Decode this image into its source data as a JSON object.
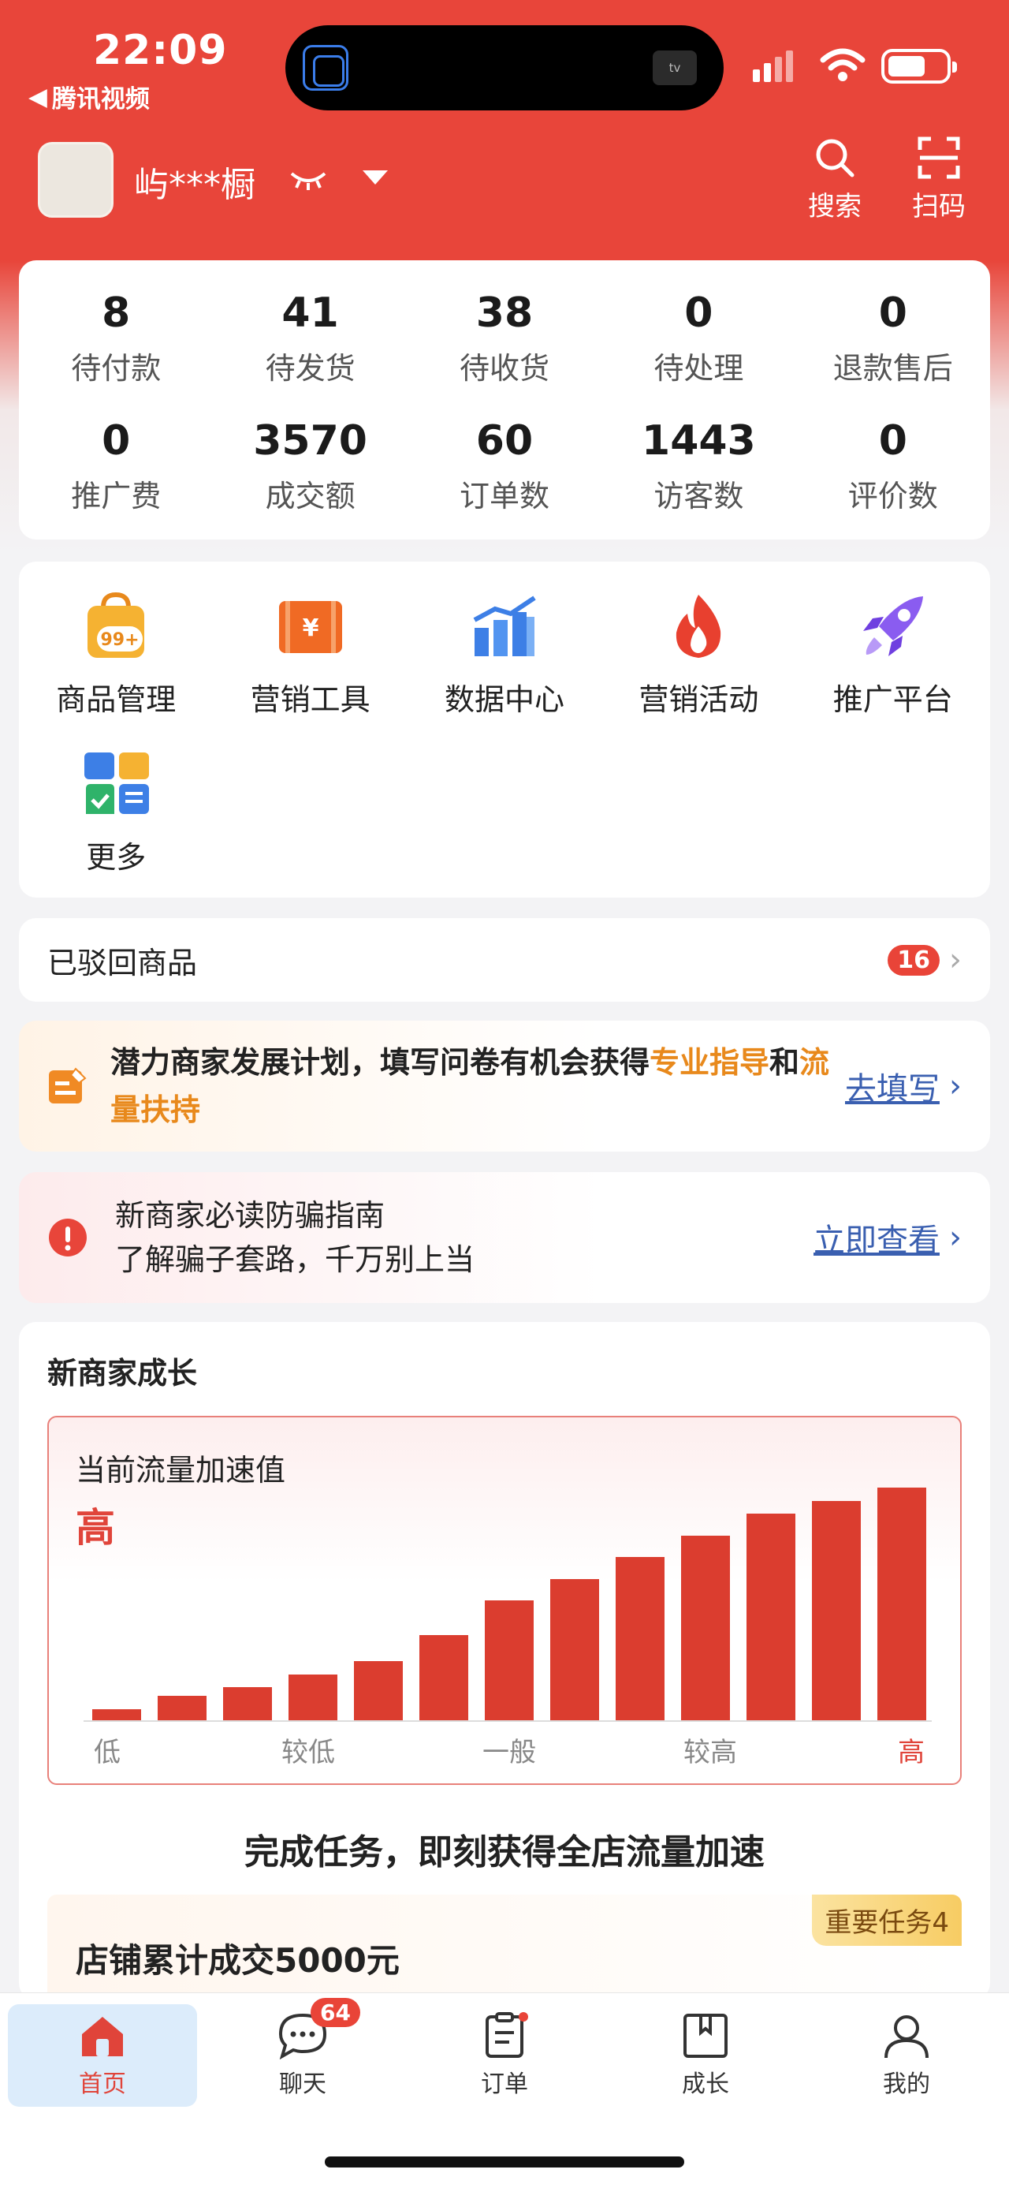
{
  "status_bar": {
    "time": "22:09",
    "back_app": "腾讯视频",
    "island_app": "tv"
  },
  "header": {
    "username": "屿***橱",
    "search_label": "搜索",
    "scan_label": "扫码"
  },
  "stats": [
    {
      "value": "8",
      "label": "待付款"
    },
    {
      "value": "41",
      "label": "待发货"
    },
    {
      "value": "38",
      "label": "待收货"
    },
    {
      "value": "0",
      "label": "待处理"
    },
    {
      "value": "0",
      "label": "退款售后"
    },
    {
      "value": "0",
      "label": "推广费"
    },
    {
      "value": "3570",
      "label": "成交额"
    },
    {
      "value": "60",
      "label": "订单数"
    },
    {
      "value": "1443",
      "label": "访客数"
    },
    {
      "value": "0",
      "label": "评价数"
    }
  ],
  "tools": [
    {
      "label": "商品管理",
      "icon": "shopping-bag-icon",
      "badge": "99+"
    },
    {
      "label": "营销工具",
      "icon": "coupon-icon",
      "badge": "¥"
    },
    {
      "label": "数据中心",
      "icon": "bar-chart-icon"
    },
    {
      "label": "营销活动",
      "icon": "fire-icon"
    },
    {
      "label": "推广平台",
      "icon": "rocket-icon"
    },
    {
      "label": "更多",
      "icon": "more-apps-icon"
    }
  ],
  "rejected": {
    "label": "已驳回商品",
    "count": "16"
  },
  "plan": {
    "text_a": "潜力商家发展计划，填写问卷有机会获得",
    "highlight_a": "专业指导",
    "text_b": "和",
    "highlight_b": "流量扶持",
    "action": "去填写"
  },
  "guide": {
    "title": "新商家必读防骗指南",
    "subtitle": "了解骗子套路，千万别上当",
    "action": "立即查看"
  },
  "growth": {
    "section_title": "新商家成长",
    "metric_label": "当前流量加速值",
    "metric_value": "高",
    "task_heading": "完成任务，即刻获得全店流量加速",
    "task_title": "店铺累计成交5000元",
    "task_badge": "重要任务4"
  },
  "chart_data": {
    "type": "bar",
    "categories": [
      "1",
      "2",
      "3",
      "4",
      "5",
      "6",
      "7",
      "8",
      "9",
      "10",
      "11",
      "12",
      "13"
    ],
    "values": [
      3,
      6,
      8,
      11,
      14,
      20,
      28,
      33,
      38,
      43,
      48,
      51,
      54
    ],
    "ylim": [
      0,
      60
    ],
    "tick_labels": [
      "低",
      "较低",
      "一般",
      "较高",
      "高"
    ],
    "grid": false,
    "legend": "none"
  },
  "nav": {
    "home": "首页",
    "chat": "聊天",
    "chat_badge": "64",
    "orders": "订单",
    "growth": "成长",
    "mine": "我的"
  },
  "colors": {
    "brand_red": "#e8453a",
    "accent_orange": "#e8891c",
    "link_blue": "#3a5fb0"
  }
}
